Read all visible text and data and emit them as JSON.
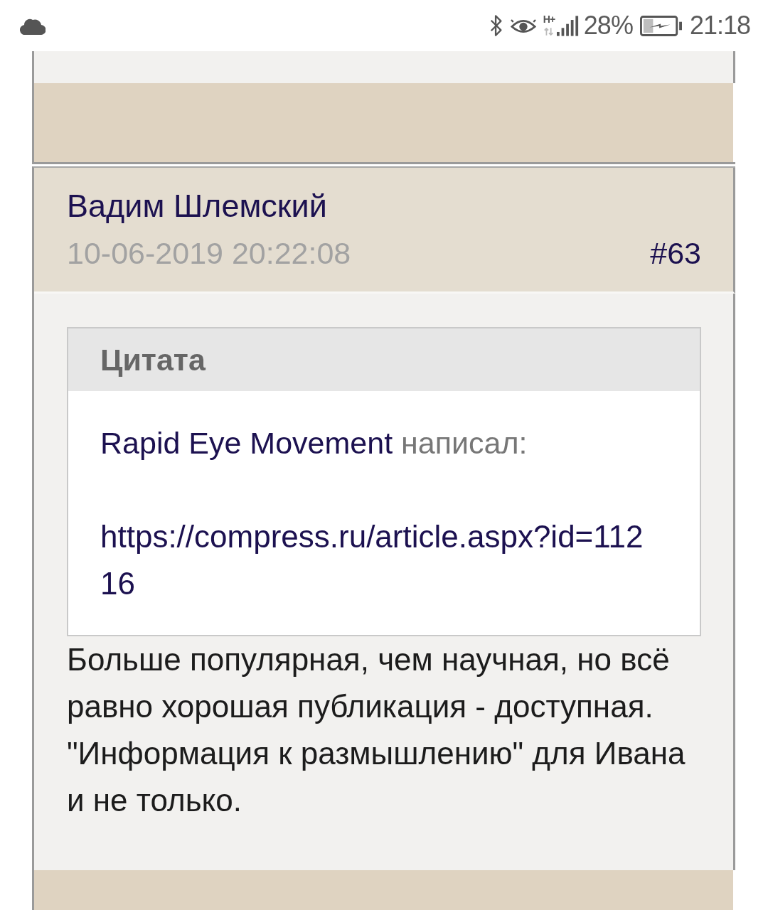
{
  "status_bar": {
    "network_type": "H+",
    "battery": "28%",
    "time": "21:18"
  },
  "post": {
    "author": "Вадим Шлемский",
    "date": "10-06-2019 20:22:08",
    "number": "#63",
    "quote": {
      "title": "Цитата",
      "author": "Rapid Eye Movement",
      "verb": "написал:",
      "url": "https://compress.ru/article.aspx?id=11216"
    },
    "text": "Больше популярная, чем научная, но всё равно хорошая публикация - доступная. \"Информация к размышлению\" для Ивана и не только."
  }
}
